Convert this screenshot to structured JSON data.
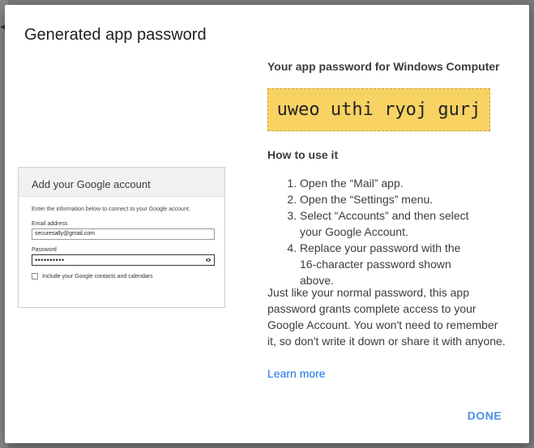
{
  "dialog": {
    "title": "Generated app password",
    "done_label": "DONE"
  },
  "illustration": {
    "header": "Add your Google account",
    "instructions": "Enter the information below to connect to your Google account.",
    "email_label": "Email address",
    "email_value": "securesally@gmail.com",
    "password_label": "Password",
    "password_value": "••••••••••",
    "checkbox_label": "Include your Google contacts and calendars"
  },
  "password_panel": {
    "heading": "Your app password for Windows Computer",
    "password": "uweo uthi ryoj gurj"
  },
  "howto": {
    "heading": "How to use it",
    "steps": [
      "Open the “Mail” app.",
      "Open the “Settings” menu.",
      "Select “Accounts” and then select your Google Account.",
      "Replace your password with the 16-character password shown above."
    ],
    "explanation": "Just like your normal password, this app password grants complete access to your Google Account. You won't need to remember it, so don't write it down or share it with anyone.",
    "learn_more": "Learn more"
  },
  "colors": {
    "password_highlight": "#f9d264",
    "link": "#1a73e8",
    "button": "#4a90e2"
  }
}
